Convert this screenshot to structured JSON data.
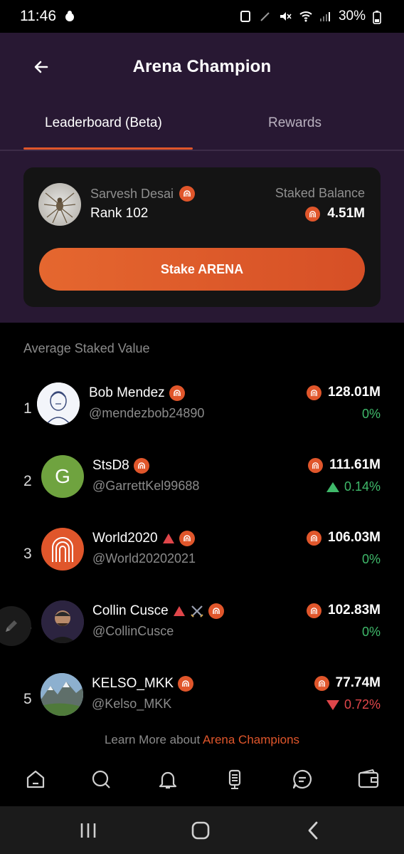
{
  "status_bar": {
    "time": "11:46",
    "battery": "30%"
  },
  "header": {
    "title": "Arena Champion"
  },
  "tabs": [
    {
      "label": "Leaderboard (Beta)",
      "active": true
    },
    {
      "label": "Rewards",
      "active": false
    }
  ],
  "user_card": {
    "name": "Sarvesh Desai",
    "rank": "Rank 102",
    "staked_label": "Staked Balance",
    "staked_value": "4.51M",
    "stake_button": "Stake ARENA"
  },
  "section_label": "Average Staked Value",
  "leaderboard": [
    {
      "rank": "1",
      "name": "Bob Mendez",
      "handle": "@mendezbob24890",
      "value": "128.01M",
      "change": "0%",
      "trend": "flat"
    },
    {
      "rank": "2",
      "name": "StsD8",
      "handle": "@GarrettKel99688",
      "value": "111.61M",
      "change": "0.14%",
      "trend": "up",
      "avatar_letter": "G"
    },
    {
      "rank": "3",
      "name": "World2020",
      "handle": "@World20202021",
      "value": "106.03M",
      "change": "0%",
      "trend": "flat"
    },
    {
      "rank": "4",
      "name": "Collin Cusce",
      "handle": "@CollinCusce",
      "value": "102.83M",
      "change": "0%",
      "trend": "flat"
    },
    {
      "rank": "5",
      "name": "KELSO_MKK",
      "handle": "@Kelso_MKK",
      "value": "77.74M",
      "change": "0.72%",
      "trend": "down"
    }
  ],
  "footer": {
    "prefix": "Learn More about ",
    "link": "Arena Champions"
  },
  "bottom_nav": [
    {
      "icon": "home-icon"
    },
    {
      "icon": "search-icon"
    },
    {
      "icon": "bell-icon"
    },
    {
      "icon": "ticket-icon"
    },
    {
      "icon": "chat-icon"
    },
    {
      "icon": "wallet-icon"
    }
  ],
  "colors": {
    "accent": "#e0562b",
    "panel": "#281833",
    "card": "#141414",
    "up": "#3fb96a",
    "down": "#e0464a"
  }
}
